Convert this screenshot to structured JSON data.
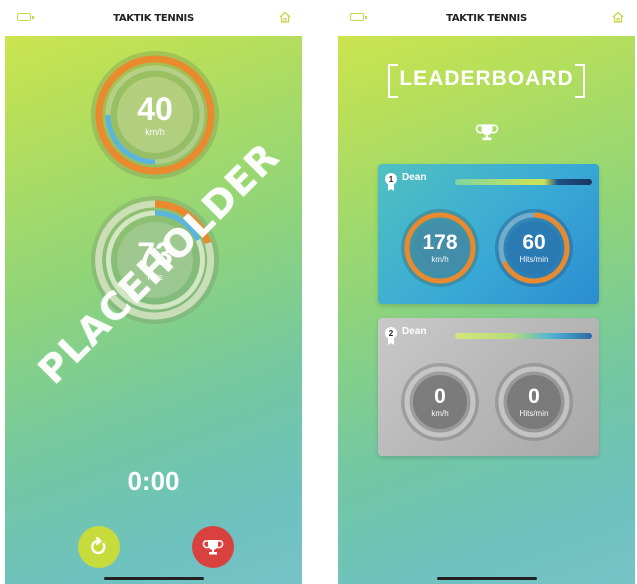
{
  "app_title": "TAKTIK TENNIS",
  "left_screen": {
    "speed_gauge": {
      "value": "40",
      "unit": "km/h"
    },
    "hits_gauge": {
      "value": "73",
      "unit": "Hits"
    },
    "watermark": "PLACEHOLDER",
    "timer": "0:00",
    "buttons": {
      "restart_icon": "restart-icon",
      "leaderboard_icon": "trophy-icon"
    }
  },
  "right_screen": {
    "title": "LEADERBOARD",
    "entries": [
      {
        "rank": "1",
        "name": "Dean",
        "bar_left_label": "",
        "bar_right_label": "",
        "speed": {
          "value": "178",
          "unit": "km/h"
        },
        "hits": {
          "value": "60",
          "unit": "Hits/min"
        }
      },
      {
        "rank": "2",
        "name": "Dean",
        "bar_left_label": "",
        "bar_right_label": "",
        "speed": {
          "value": "0",
          "unit": "km/h"
        },
        "hits": {
          "value": "0",
          "unit": "Hits/min"
        }
      }
    ]
  },
  "colors": {
    "accent_orange": "#e98a2e",
    "accent_blue": "#5ab4e0",
    "restart_button": "#c8db3c",
    "leaderboard_button": "#d9413f",
    "card_1": "#39a9d6",
    "card_2": "#b6b6b6"
  }
}
